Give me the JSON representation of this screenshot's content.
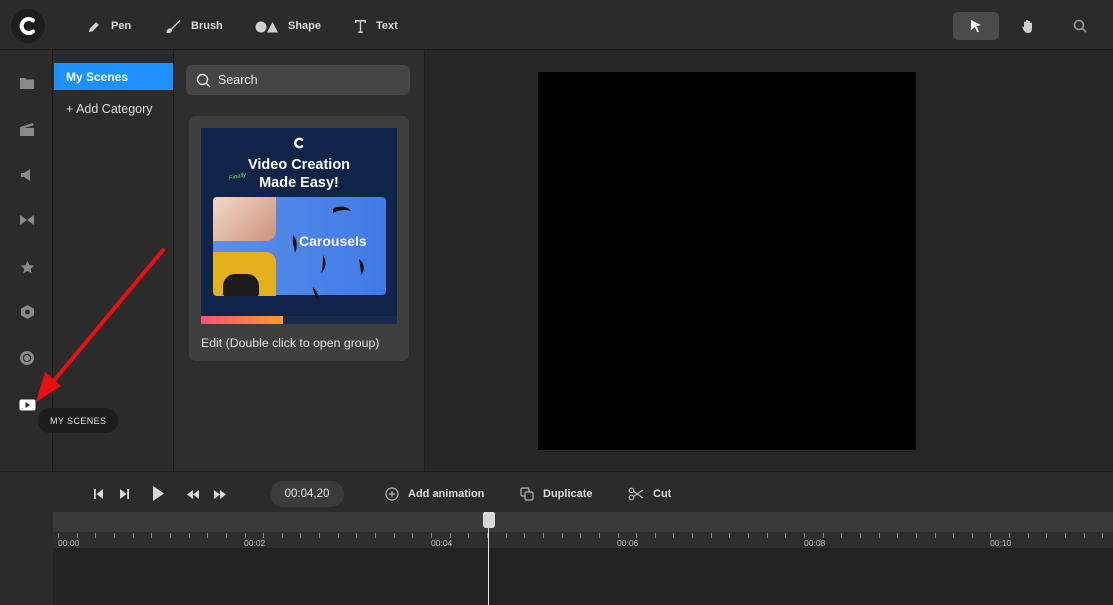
{
  "toolbar": {
    "pen_label": "Pen",
    "brush_label": "Brush",
    "shape_label": "Shape",
    "text_label": "Text"
  },
  "sidebar": {
    "tooltip": "MY SCENES"
  },
  "categories": {
    "active": "My Scenes",
    "add_label": "+ Add Category"
  },
  "scenes": {
    "search_placeholder": "Search",
    "card": {
      "title_line1": "Video Creation",
      "title_line2": "Made Easy!",
      "finally_text": "Finally",
      "carousel_text": "Carousels",
      "caption": "Edit (Double click to open group)"
    }
  },
  "timeline": {
    "current_time": "00:04,20",
    "add_animation_label": "Add animation",
    "duplicate_label": "Duplicate",
    "cut_label": "Cut",
    "ticks": [
      "00:00",
      "00:02",
      "00:04",
      "00:06",
      "00:08",
      "00:10"
    ]
  },
  "colors": {
    "accent": "#1e90ff",
    "annotation_arrow": "#e81010"
  }
}
